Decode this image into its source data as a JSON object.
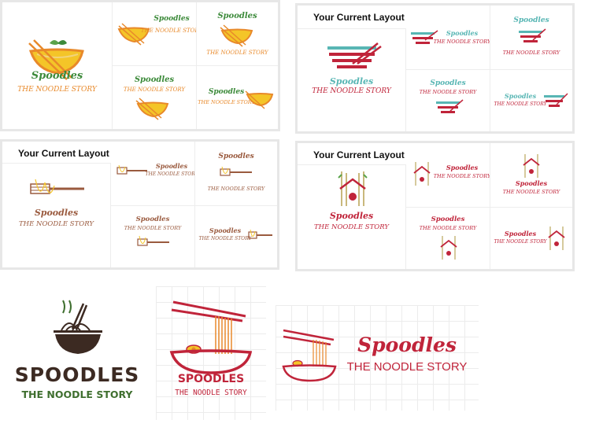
{
  "brand": {
    "name": "Spoodles",
    "name_caps": "SPOODLES",
    "tagline": "THE NOODLE STORY"
  },
  "panels": {
    "current_layout_label": "Your Current Layout"
  },
  "colors": {
    "orange": "#e8892a",
    "yellow": "#f4c528",
    "green": "#3c8a3a",
    "teal": "#58b6b4",
    "crimson": "#c0243a",
    "brown": "#9a5a3e",
    "bamboo": "#c9b87c",
    "dark": "#3c2a22",
    "darkgreen": "#3f6f2f"
  },
  "icons": [
    "noodle-bowl-icon",
    "chopsticks-icon",
    "fork-icon",
    "bamboo-hut-icon",
    "ramen-bowl-icon"
  ]
}
